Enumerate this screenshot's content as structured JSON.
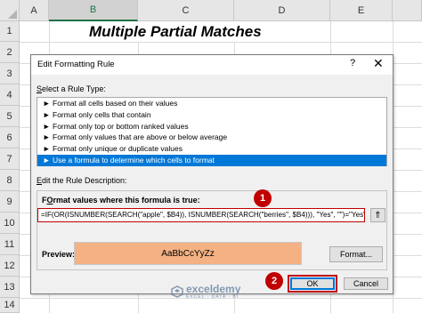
{
  "sheet": {
    "columns": [
      "A",
      "B",
      "C",
      "D",
      "E"
    ],
    "selected_column": "B",
    "rows": [
      "1",
      "2",
      "3",
      "4",
      "5",
      "6",
      "7",
      "8",
      "9",
      "10",
      "11",
      "12",
      "13",
      "14"
    ],
    "selected_rows": [
      "4",
      "5",
      "6",
      "7",
      "8",
      "9",
      "10",
      "11",
      "12",
      "13"
    ],
    "title_cell": "Multiple Partial Matches"
  },
  "dialog": {
    "title": "Edit Formatting Rule",
    "help_glyph": "?",
    "close_glyph": "✕",
    "select_type_label_key": "S",
    "select_type_label_rest": "elect a Rule Type:",
    "rule_types": [
      "Format all cells based on their values",
      "Format only cells that contain",
      "Format only top or bottom ranked values",
      "Format only values that are above or below average",
      "Format only unique or duplicate values",
      "Use a formula to determine which cells to format"
    ],
    "selected_rule_index": 5,
    "rule_arrow": "►",
    "edit_desc_label_key": "E",
    "edit_desc_label_rest": "dit the Rule Description:",
    "formula_label_key": "O",
    "formula_label_pre": "F",
    "formula_label_rest": "rmat values where this formula is true:",
    "formula_value": "=IF(OR(ISNUMBER(SEARCH(\"apple\", $B4)), ISNUMBER(SEARCH(\"berries\", $B4))), \"Yes\", \"\")=\"Yes\"",
    "collapse_glyph": "⇑",
    "preview_label": "Preview:",
    "preview_text": "AaBbCcYyZz",
    "preview_color": "#f4b183",
    "format_button": "Format...",
    "ok_button": "OK",
    "cancel_button": "Cancel"
  },
  "callouts": {
    "first": "1",
    "second": "2",
    "color": "#c00000"
  },
  "watermark": {
    "name": "exceldemy",
    "tagline": "EXCEL · DATA · BI"
  }
}
